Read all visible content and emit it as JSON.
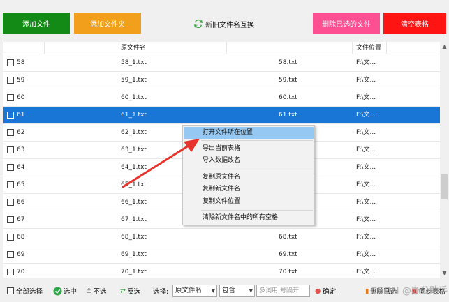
{
  "toolbar": {
    "add_file": "添加文件",
    "add_folder": "添加文件夹",
    "swap": "新旧文件名互换",
    "delete_selected": "删除已选的文件",
    "clear_table": "清空表格"
  },
  "table": {
    "headers": {
      "original": "原文件名",
      "location": "文件位置"
    },
    "rows": [
      {
        "idx": "58",
        "orig": "58_1.txt",
        "new": "58.txt",
        "loc": "F:\\文..."
      },
      {
        "idx": "59",
        "orig": "59_1.txt",
        "new": "59.txt",
        "loc": "F:\\文..."
      },
      {
        "idx": "60",
        "orig": "60_1.txt",
        "new": "60.txt",
        "loc": "F:\\文..."
      },
      {
        "idx": "61",
        "orig": "61_1.txt",
        "new": "61.txt",
        "loc": "F:\\文..."
      },
      {
        "idx": "62",
        "orig": "62_1.txt",
        "new": "",
        "loc": "F:\\文..."
      },
      {
        "idx": "63",
        "orig": "63_1.txt",
        "new": "",
        "loc": "F:\\文..."
      },
      {
        "idx": "64",
        "orig": "64_1.txt",
        "new": "",
        "loc": "F:\\文..."
      },
      {
        "idx": "65",
        "orig": "65_1.txt",
        "new": "",
        "loc": "F:\\文..."
      },
      {
        "idx": "66",
        "orig": "66_1.txt",
        "new": "",
        "loc": "F:\\文..."
      },
      {
        "idx": "67",
        "orig": "67_1.txt",
        "new": "",
        "loc": "F:\\文..."
      },
      {
        "idx": "68",
        "orig": "68_1.txt",
        "new": "68.txt",
        "loc": "F:\\文..."
      },
      {
        "idx": "69",
        "orig": "69_1.txt",
        "new": "69.txt",
        "loc": "F:\\文..."
      },
      {
        "idx": "70",
        "orig": "70_1.txt",
        "new": "70.txt",
        "loc": "F:\\文..."
      }
    ]
  },
  "context_menu": {
    "open_location": "打开文件所在位置",
    "export_table": "导出当前表格",
    "import_data": "导入数据改名",
    "copy_original": "复制原文件名",
    "copy_new": "复制新文件名",
    "copy_location": "复制文件位置",
    "clear_spaces": "清除新文件名中的所有空格"
  },
  "bottombar": {
    "select_all": "全部选择",
    "select": "选中",
    "unselect": "不选",
    "invert": "反选",
    "choose_label": "选择:",
    "field_value": "原文件名",
    "match_value": "包含",
    "keyword_placeholder": "多词用|号隔开",
    "confirm": "确定",
    "delete_selected": "删除已选",
    "same_table": "同步表格"
  },
  "watermark": "CSDN @办公助手",
  "colors": {
    "green": "#138a15",
    "orange": "#f2a01c",
    "pink": "#ff4f93",
    "red": "#ff1414",
    "selected_row": "#1976d6",
    "menu_highlight": "#95c8f2"
  }
}
